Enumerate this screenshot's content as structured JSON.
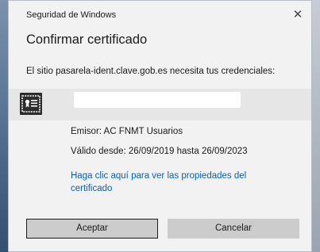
{
  "window": {
    "title": "Seguridad de Windows",
    "close_glyph": "✕"
  },
  "dialog": {
    "heading": "Confirmar certificado",
    "message": "El sitio pasarela-ident.clave.gob.es necesita tus credenciales:"
  },
  "certificate": {
    "icon": "certificate-icon",
    "name_redacted": "",
    "issuer": "Emisor: AC FNMT Usuarios",
    "validity": "Válido desde: 26/09/2019 hasta 26/09/2023",
    "properties_link": "Haga clic aquí para ver las propiedades del certificado"
  },
  "buttons": {
    "accept": "Aceptar",
    "cancel": "Cancelar"
  },
  "colors": {
    "dialog_bg": "#f2f2f2",
    "link": "#0b5fb0",
    "button_bg": "#cccccc",
    "selected_row": "#e6e6e6"
  }
}
